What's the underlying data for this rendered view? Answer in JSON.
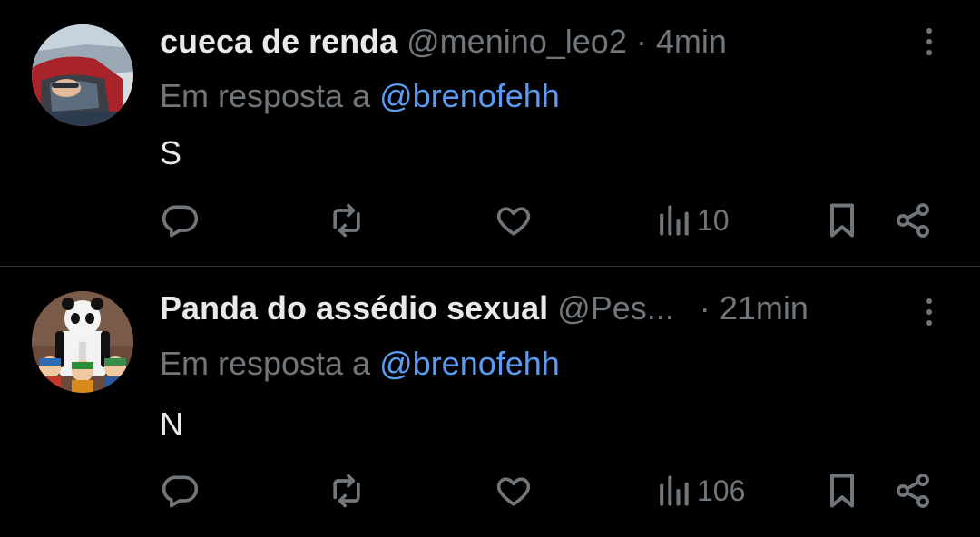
{
  "tweets": [
    {
      "name": "cueca de renda",
      "handle": "@menino_leo2",
      "separator": "·",
      "time": "4min",
      "reply_prefix": "Em resposta a",
      "reply_to": "@brenofehh",
      "text": "S",
      "views": "10",
      "avatar": "car-photo-avatar"
    },
    {
      "name": "Panda do assédio sexual",
      "handle": "@Pes...",
      "separator": "·",
      "time": "21min",
      "reply_prefix": "Em resposta a",
      "reply_to": "@brenofehh",
      "text": "N",
      "views": "106",
      "avatar": "panda-cartoon-avatar"
    }
  ],
  "colors": {
    "background": "#000000",
    "text": "#e7e9ea",
    "muted": "#71767b",
    "link": "#5b9cf2",
    "divider": "#2f3336"
  },
  "icons": [
    "reply-icon",
    "repost-icon",
    "like-icon",
    "views-icon",
    "bookmark-icon",
    "share-icon",
    "more-icon"
  ]
}
